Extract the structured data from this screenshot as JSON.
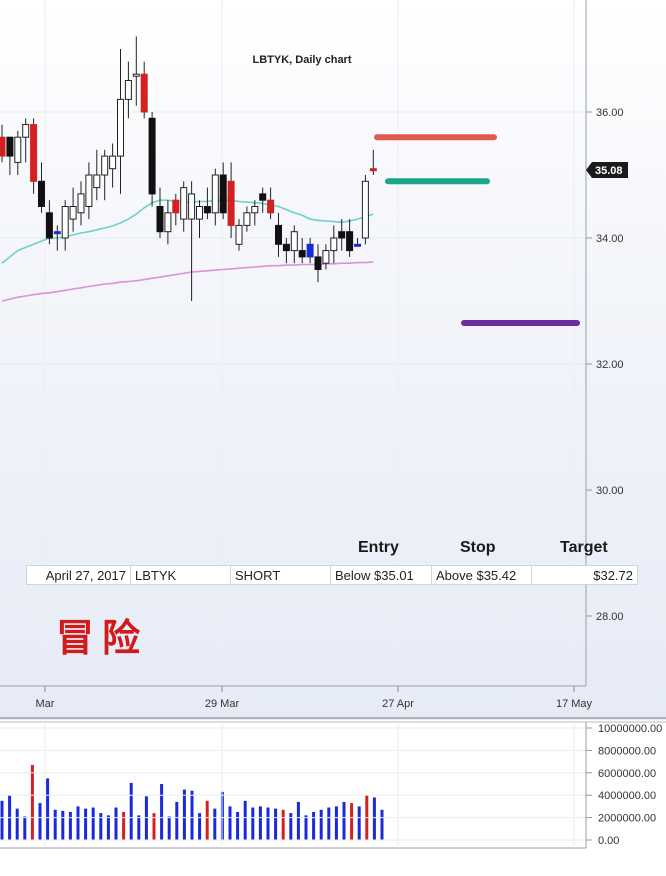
{
  "chart_data": [
    {
      "type": "candlestick",
      "title": "LBTYK, Daily chart",
      "x_tick_labels": [
        "Mar",
        "29 Mar",
        "27 Apr",
        "17 May"
      ],
      "y_tick_labels": [
        "36.00",
        "34.00",
        "32.00",
        "30.00",
        "28.00"
      ],
      "ylim": [
        26.6,
        37.8
      ],
      "last_price": "35.08",
      "grid": true,
      "candles": [
        {
          "o": 35.6,
          "h": 35.8,
          "l": 35.2,
          "c": 35.3,
          "color": "red"
        },
        {
          "o": 35.3,
          "h": 35.6,
          "l": 35.0,
          "c": 35.6,
          "color": "black"
        },
        {
          "o": 35.2,
          "h": 35.7,
          "l": 35.0,
          "c": 35.6,
          "color": "white"
        },
        {
          "o": 35.6,
          "h": 35.9,
          "l": 35.2,
          "c": 35.8,
          "color": "white"
        },
        {
          "o": 35.8,
          "h": 35.9,
          "l": 34.7,
          "c": 34.9,
          "color": "red"
        },
        {
          "o": 34.9,
          "h": 35.2,
          "l": 34.4,
          "c": 34.5,
          "color": "black"
        },
        {
          "o": 34.4,
          "h": 34.6,
          "l": 33.9,
          "c": 34.0,
          "color": "black"
        },
        {
          "o": 34.1,
          "h": 34.2,
          "l": 33.8,
          "c": 34.1,
          "color": "blue"
        },
        {
          "o": 34.0,
          "h": 34.6,
          "l": 33.8,
          "c": 34.5,
          "color": "white"
        },
        {
          "o": 34.3,
          "h": 34.8,
          "l": 34.1,
          "c": 34.5,
          "color": "white"
        },
        {
          "o": 34.4,
          "h": 34.9,
          "l": 34.2,
          "c": 34.7,
          "color": "white"
        },
        {
          "o": 34.5,
          "h": 35.2,
          "l": 34.3,
          "c": 35.0,
          "color": "white"
        },
        {
          "o": 34.8,
          "h": 35.4,
          "l": 34.6,
          "c": 35.0,
          "color": "white"
        },
        {
          "o": 35.0,
          "h": 35.4,
          "l": 34.6,
          "c": 35.3,
          "color": "white"
        },
        {
          "o": 35.1,
          "h": 35.5,
          "l": 34.8,
          "c": 35.3,
          "color": "white"
        },
        {
          "o": 35.3,
          "h": 37.0,
          "l": 34.7,
          "c": 36.2,
          "color": "white"
        },
        {
          "o": 36.2,
          "h": 36.8,
          "l": 35.9,
          "c": 36.5,
          "color": "white"
        },
        {
          "o": 36.6,
          "h": 37.2,
          "l": 36.1,
          "c": 36.6,
          "color": "white"
        },
        {
          "o": 36.6,
          "h": 36.8,
          "l": 35.9,
          "c": 36.0,
          "color": "red"
        },
        {
          "o": 35.9,
          "h": 36.0,
          "l": 34.5,
          "c": 34.7,
          "color": "black"
        },
        {
          "o": 34.5,
          "h": 34.8,
          "l": 34.0,
          "c": 34.1,
          "color": "black"
        },
        {
          "o": 34.1,
          "h": 34.6,
          "l": 33.9,
          "c": 34.4,
          "color": "white"
        },
        {
          "o": 34.6,
          "h": 34.7,
          "l": 34.2,
          "c": 34.4,
          "color": "red"
        },
        {
          "o": 34.3,
          "h": 34.9,
          "l": 34.1,
          "c": 34.8,
          "color": "white"
        },
        {
          "o": 34.7,
          "h": 34.9,
          "l": 33.0,
          "c": 34.3,
          "color": "white"
        },
        {
          "o": 34.3,
          "h": 34.6,
          "l": 34.0,
          "c": 34.5,
          "color": "white"
        },
        {
          "o": 34.5,
          "h": 34.8,
          "l": 34.3,
          "c": 34.4,
          "color": "black"
        },
        {
          "o": 34.4,
          "h": 35.1,
          "l": 34.2,
          "c": 35.0,
          "color": "white"
        },
        {
          "o": 35.0,
          "h": 35.2,
          "l": 34.3,
          "c": 34.4,
          "color": "black"
        },
        {
          "o": 34.9,
          "h": 35.2,
          "l": 34.0,
          "c": 34.2,
          "color": "red"
        },
        {
          "o": 33.9,
          "h": 34.3,
          "l": 33.8,
          "c": 34.2,
          "color": "white"
        },
        {
          "o": 34.2,
          "h": 34.5,
          "l": 34.1,
          "c": 34.4,
          "color": "white"
        },
        {
          "o": 34.4,
          "h": 34.6,
          "l": 34.2,
          "c": 34.5,
          "color": "white"
        },
        {
          "o": 34.6,
          "h": 34.8,
          "l": 34.4,
          "c": 34.7,
          "color": "black"
        },
        {
          "o": 34.6,
          "h": 34.8,
          "l": 34.3,
          "c": 34.4,
          "color": "red"
        },
        {
          "o": 34.2,
          "h": 34.4,
          "l": 33.7,
          "c": 33.9,
          "color": "black"
        },
        {
          "o": 33.9,
          "h": 34.0,
          "l": 33.6,
          "c": 33.8,
          "color": "black"
        },
        {
          "o": 33.8,
          "h": 34.2,
          "l": 33.6,
          "c": 34.1,
          "color": "white"
        },
        {
          "o": 33.8,
          "h": 34.0,
          "l": 33.6,
          "c": 33.7,
          "color": "black"
        },
        {
          "o": 33.9,
          "h": 34.0,
          "l": 33.6,
          "c": 33.7,
          "color": "blue"
        },
        {
          "o": 33.7,
          "h": 33.9,
          "l": 33.3,
          "c": 33.5,
          "color": "black"
        },
        {
          "o": 33.6,
          "h": 33.9,
          "l": 33.5,
          "c": 33.8,
          "color": "white"
        },
        {
          "o": 33.8,
          "h": 34.2,
          "l": 33.6,
          "c": 34.0,
          "color": "white"
        },
        {
          "o": 34.0,
          "h": 34.3,
          "l": 33.8,
          "c": 34.1,
          "color": "black"
        },
        {
          "o": 34.1,
          "h": 34.3,
          "l": 33.7,
          "c": 33.8,
          "color": "black"
        },
        {
          "o": 33.9,
          "h": 34.0,
          "l": 33.9,
          "c": 33.9,
          "color": "blue"
        },
        {
          "o": 34.0,
          "h": 35.0,
          "l": 33.9,
          "c": 34.9,
          "color": "white"
        },
        {
          "o": 35.1,
          "h": 35.4,
          "l": 35.0,
          "c": 35.1,
          "color": "red"
        }
      ],
      "moving_averages": [
        {
          "name": "short",
          "color": "#6fd0c8",
          "values": [
            33.6,
            33.7,
            33.8,
            33.85,
            33.9,
            33.95,
            34.0,
            34.0,
            34.02,
            34.05,
            34.08,
            34.1,
            34.13,
            34.16,
            34.19,
            34.24,
            34.3,
            34.38,
            34.48,
            34.56,
            34.6,
            34.6,
            34.58,
            34.58,
            34.57,
            34.58,
            34.58,
            34.6,
            34.6,
            34.6,
            34.58,
            34.57,
            34.56,
            34.55,
            34.52,
            34.5,
            34.45,
            34.4,
            34.36,
            34.3,
            34.28,
            34.27,
            34.26,
            34.25,
            34.27,
            34.3,
            34.34,
            34.38
          ]
        },
        {
          "name": "long",
          "color": "#dd92d6",
          "values": [
            33.0,
            33.03,
            33.06,
            33.08,
            33.1,
            33.12,
            33.13,
            33.15,
            33.17,
            33.19,
            33.21,
            33.23,
            33.25,
            33.27,
            33.28,
            33.3,
            33.31,
            33.32,
            33.34,
            33.36,
            33.38,
            33.4,
            33.42,
            33.44,
            33.46,
            33.47,
            33.48,
            33.49,
            33.5,
            33.51,
            33.52,
            33.53,
            33.54,
            33.55,
            33.56,
            33.56,
            33.57,
            33.57,
            33.58,
            33.58,
            33.58,
            33.59,
            33.59,
            33.6,
            33.6,
            33.61,
            33.61,
            33.62
          ]
        }
      ],
      "levels": [
        {
          "name": "stop",
          "value": 35.6,
          "color": "#e05a4f"
        },
        {
          "name": "entry",
          "value": 34.9,
          "color": "#1aa68a"
        },
        {
          "name": "target",
          "value": 32.65,
          "color": "#6a2c9a"
        }
      ]
    },
    {
      "type": "bar",
      "y_tick_labels": [
        "10000000.00",
        "8000000.00",
        "6000000.00",
        "4000000.00",
        "2000000.00",
        "0.00"
      ],
      "ylim": [
        0,
        10000000
      ],
      "values": [
        3500000,
        4000000,
        2800000,
        2100000,
        6700000,
        3300000,
        5500000,
        2700000,
        2600000,
        2500000,
        3000000,
        2800000,
        2900000,
        2400000,
        2200000,
        2900000,
        2500000,
        5100000,
        2200000,
        3900000,
        2400000,
        5000000,
        2100000,
        3400000,
        4500000,
        4400000,
        2400000,
        3500000,
        2800000,
        4300000,
        3000000,
        2500000,
        3500000,
        2900000,
        3000000,
        2900000,
        2800000,
        2700000,
        2400000,
        3400000,
        2200000,
        2500000,
        2700000,
        2900000,
        3000000,
        3400000,
        3300000,
        3000000,
        4000000,
        3800000,
        2700000
      ],
      "colors": [
        "blue",
        "blue",
        "blue",
        "blue",
        "red",
        "blue",
        "blue",
        "blue",
        "blue",
        "blue",
        "blue",
        "blue",
        "blue",
        "blue",
        "blue",
        "blue",
        "red",
        "blue",
        "blue",
        "blue",
        "red",
        "blue",
        "blue",
        "blue",
        "blue",
        "blue",
        "blue",
        "red",
        "blue",
        "blue",
        "blue",
        "blue",
        "blue",
        "blue",
        "blue",
        "blue",
        "blue",
        "red",
        "blue",
        "blue",
        "blue",
        "blue",
        "blue",
        "blue",
        "blue",
        "blue",
        "red",
        "blue",
        "red",
        "blue",
        "blue"
      ]
    }
  ],
  "trade": {
    "headers": {
      "entry": "Entry",
      "stop": "Stop",
      "target": "Target"
    },
    "row": {
      "date": "April 27, 2017",
      "symbol": "LBTYK",
      "direction": "SHORT",
      "entry": "Below $35.01",
      "stop": "Above $35.42",
      "target": "$32.72"
    }
  },
  "stamp_text": "冒险"
}
